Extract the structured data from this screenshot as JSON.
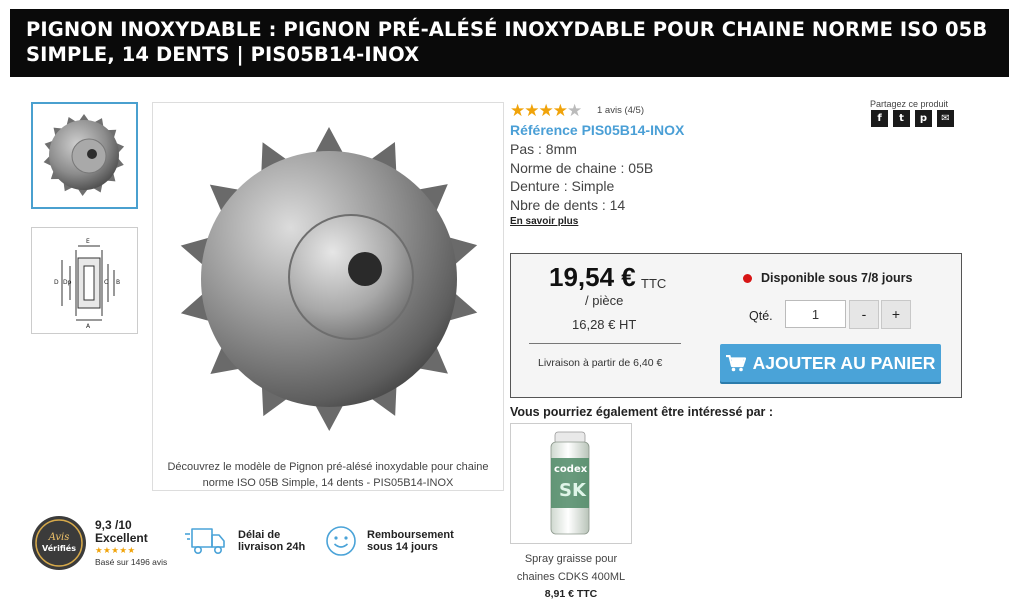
{
  "page": {
    "title": "PIGNON INOXYDABLE : PIGNON PRÉ-ALÉSÉ INOXYDABLE POUR CHAINE NORME ISO 05B SIMPLE, 14 DENTS | PIS05B14-INOX"
  },
  "gallery": {
    "caption": "Découvrez le modèle de Pignon pré-alésé inoxydable pour chaine norme ISO 05B Simple, 14 dents - PIS05B14-INOX",
    "diagram_labels": [
      "E",
      "D",
      "Dp",
      "C",
      "B",
      "A"
    ]
  },
  "rating": {
    "stars": 4,
    "max": 5,
    "label": "1 avis (4/5)"
  },
  "share": {
    "label": "Partagez ce produit",
    "icons": [
      "facebook-icon",
      "twitter-icon",
      "pinterest-icon",
      "email-icon"
    ]
  },
  "product": {
    "reference": "Référence PIS05B14-INOX",
    "specs": [
      "Pas : 8mm",
      "Norme de chaine : 05B",
      "Denture : Simple",
      "Nbre de dents : 14"
    ],
    "more_link": "En savoir plus"
  },
  "buy": {
    "price": "19,54 €",
    "tax_label": "TTC",
    "unit": "/ pièce",
    "price_ht": "16,28 € HT",
    "delivery": "Livraison à partir de 6,40 €",
    "availability": "Disponible sous 7/8 jours",
    "availability_color": "#d71515",
    "qty_label": "Qté.",
    "qty_value": "1",
    "minus": "-",
    "plus": "+",
    "add_to_cart": "AJOUTER AU PANIER",
    "accent_color": "#4aa3d8"
  },
  "recommendations": {
    "heading": "Vous pourriez également être intéressé par :",
    "items": [
      {
        "name": "Spray graisse pour chaines CDKS 400ML",
        "price": "8,91 € TTC",
        "can_brand": "codex",
        "can_label": "SK"
      }
    ]
  },
  "reviews": {
    "badge_line1": "Avis",
    "badge_line2": "Vérifiés",
    "score": "9,3 /10",
    "verdict": "Excellent",
    "stars": "★★★★★",
    "based_on": "Basé sur 1496 avis"
  },
  "trust": [
    {
      "line1": "Délai de",
      "line2": "livraison 24h",
      "icon": "truck-icon"
    },
    {
      "line1": "Remboursement",
      "line2": "sous 14 jours",
      "icon": "smiley-icon"
    }
  ]
}
